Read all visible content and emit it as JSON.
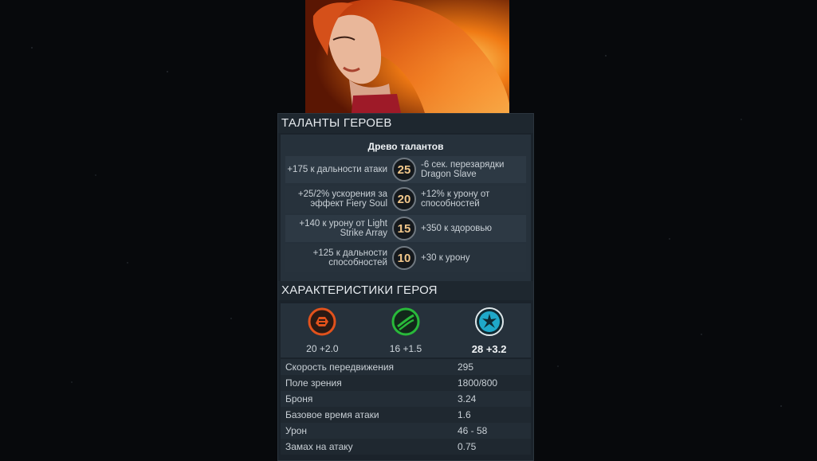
{
  "talents": {
    "section_title": "ТАЛАНТЫ ГЕРОЕВ",
    "tree_title": "Древо талантов",
    "rows": [
      {
        "level": "25",
        "left": "+175 к дальности атаки",
        "right": "-6 сек. перезарядки Dragon Slave"
      },
      {
        "level": "20",
        "left": "+25/2% ускорения за эффект Fiery Soul",
        "right": "+12% к урону от способностей"
      },
      {
        "level": "15",
        "left": "+140 к урону от Light Strike Array",
        "right": "+350 к здоровью"
      },
      {
        "level": "10",
        "left": "+125 к дальности способностей",
        "right": "+30 к урону"
      }
    ]
  },
  "stats": {
    "section_title": "ХАРАКТЕРИСТИКИ ГЕРОЯ",
    "attributes": [
      {
        "icon": "strength-icon",
        "value": "20 +2.0",
        "color": "#e2521c"
      },
      {
        "icon": "agility-icon",
        "value": "16 +1.5",
        "color": "#29b93a"
      },
      {
        "icon": "intelligence-icon",
        "value": "28 +3.2",
        "color": "#1fa8c9"
      }
    ],
    "rows": [
      {
        "label": "Скорость передвижения",
        "value": "295"
      },
      {
        "label": "Поле зрения",
        "value": "1800/800"
      },
      {
        "label": "Броня",
        "value": "3.24"
      },
      {
        "label": "Базовое время атаки",
        "value": "1.6"
      },
      {
        "label": "Урон",
        "value": "46 - 58"
      },
      {
        "label": "Замах на атаку",
        "value": "0.75"
      }
    ]
  }
}
